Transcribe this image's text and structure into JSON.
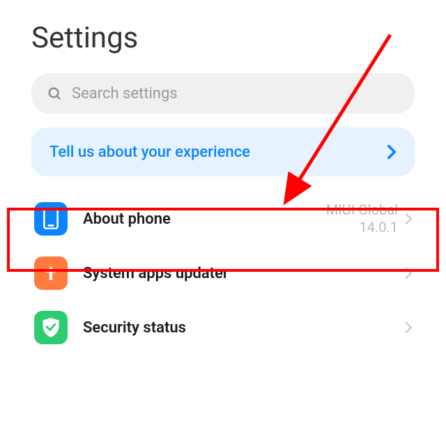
{
  "page_title": "Settings",
  "search": {
    "placeholder": "Search settings"
  },
  "banner": {
    "text": "Tell us about your experience"
  },
  "items": [
    {
      "label": "About phone",
      "value_line1": "MIUI Global",
      "value_line2": "14.0.1"
    },
    {
      "label": "System apps updater"
    },
    {
      "label": "Security status"
    }
  ],
  "annotations": {
    "highlight_target": "about-phone",
    "arrow_color": "#ff0000"
  }
}
